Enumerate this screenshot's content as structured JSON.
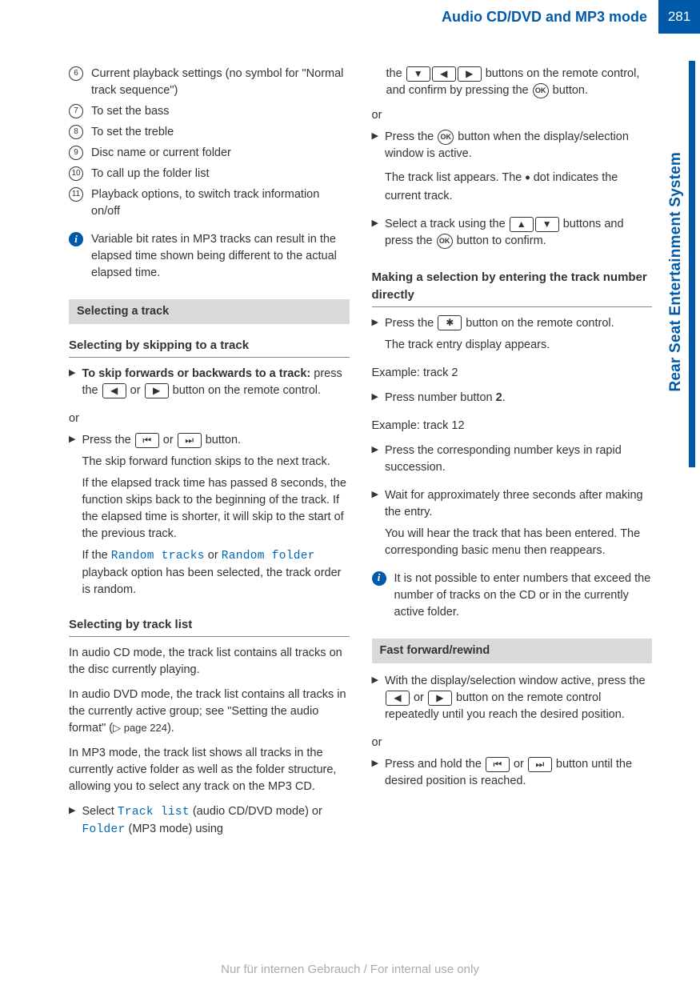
{
  "header": {
    "title": "Audio CD/DVD and MP3 mode",
    "page": "281"
  },
  "sideTab": "Rear Seat Entertainment System",
  "numbered": [
    {
      "n": "6",
      "t": "Current playback settings (no symbol for \"Normal track sequence\")"
    },
    {
      "n": "7",
      "t": "To set the bass"
    },
    {
      "n": "8",
      "t": "To set the treble"
    },
    {
      "n": "9",
      "t": "Disc name or current folder"
    },
    {
      "n": "10",
      "t": "To call up the folder list"
    },
    {
      "n": "11",
      "t": "Playback options, to switch track information on/off"
    }
  ],
  "info1": "Variable bit rates in MP3 tracks can result in the elapsed time shown being different to the actual elapsed time.",
  "sec1": {
    "bar": "Selecting a track",
    "h1": "Selecting by skipping to a track",
    "step1a": "To skip forwards or backwards to a track:",
    "step1b_before": " press the ",
    "btn_left": "◀",
    "or_word": " or ",
    "btn_right": "▶",
    "step1b_after": " button on the remote control.",
    "or": "or",
    "step2_before": "Press the ",
    "btn_prev": "⏮",
    "btn_next": "⏭",
    "step2_after": " button.",
    "step2_p1": "The skip forward function skips to the next track.",
    "step2_p2": "If the elapsed track time has passed 8 seconds, the function skips back to the beginning of the track. If the elapsed time is shorter, it will skip to the start of the previous track.",
    "step2_p3a": "If the ",
    "rt": "Random tracks",
    "step2_p3b": " or ",
    "rf": "Random folder",
    "step2_p3c": " playback option has been selected, the track order is random.",
    "h2": "Selecting by track list",
    "p_cd": "In audio CD mode, the track list contains all tracks on the disc currently playing.",
    "p_dvd_a": "In audio DVD mode, the track list contains all tracks in the currently active group; see \"Setting the audio format\" (",
    "p_dvd_ref": "▷ page 224",
    "p_dvd_b": ").",
    "p_mp3": "In MP3 mode, the track list shows all tracks in the currently active folder as well as the folder structure, allowing you to select any track on the MP3 CD.",
    "step3_before": "Select ",
    "tl": "Track list",
    "step3_mid": " (audio CD/DVD mode) or ",
    "fld": "Folder",
    "step3_after": " (MP3 mode) using"
  },
  "colR": {
    "cont_a": "the ",
    "b_down": "▼",
    "b_left": "◀",
    "b_right": "▶",
    "cont_b": " buttons on the remote control, and confirm by pressing the ",
    "ok": "OK",
    "cont_c": " button.",
    "or": "or",
    "r2_a": "Press the ",
    "r2_b": " button when the display/selection window is active.",
    "r2_c1": "The track list appears. The ",
    "r2_c2": " dot indicates the current track.",
    "r3_a": "Select a track using the ",
    "b_up": "▲",
    "r3_b": " buttons and press the ",
    "r3_c": " button to confirm.",
    "h3": "Making a selection by entering the track number directly",
    "r4_a": "Press the ",
    "star": "✱",
    "r4_b": " button on the remote control.",
    "r4_c": "The track entry display appears.",
    "ex1": "Example: track 2",
    "r5_a": "Press number button ",
    "r5_b": "2",
    "r5_c": ".",
    "ex2": "Example: track 12",
    "r6": "Press the corresponding number keys in rapid succession.",
    "r7_a": "Wait for approximately three seconds after making the entry.",
    "r7_b": "You will hear the track that has been entered. The corresponding basic menu then reappears.",
    "info2": "It is not possible to enter numbers that exceed the number of tracks on the CD or in the currently active folder.",
    "bar2": "Fast forward/rewind",
    "f1_a": "With the display/selection window active, press the ",
    "f1_b": " button on the remote control repeatedly until you reach the desired position.",
    "or2": "or",
    "f2_a": "Press and hold the ",
    "f2_b": " button until the desired position is reached."
  },
  "watermark": "Nur für internen Gebrauch / For internal use only"
}
